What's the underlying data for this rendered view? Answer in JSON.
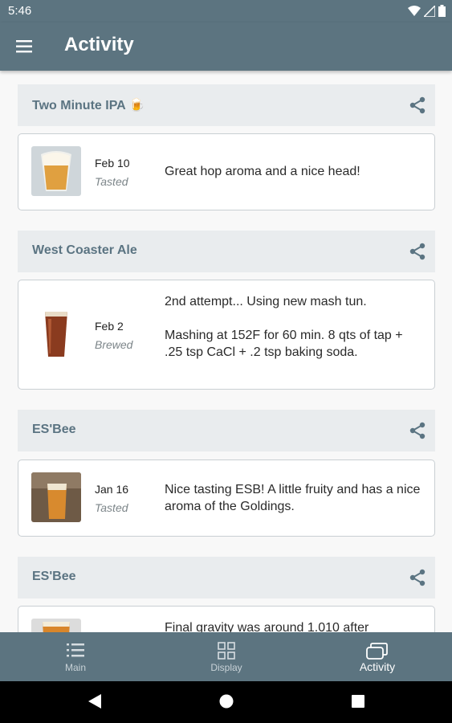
{
  "status_bar": {
    "time": "5:46"
  },
  "app_bar": {
    "title": "Activity"
  },
  "entries": [
    {
      "beer": "Two Minute IPA",
      "emoji": "🍺",
      "date": "Feb 10",
      "status": "Tasted",
      "note": "Great hop aroma and a nice head!",
      "thumb": "ipa-glass-photo"
    },
    {
      "beer": "West Coaster Ale",
      "date": "Feb 2",
      "status": "Brewed",
      "note": "2nd attempt... Using new mash tun.\n\nMashing at 152F for 60 min. 8 qts of tap + .25 tsp CaCl + .2 tsp baking soda.",
      "thumb": "pint-glass-icon"
    },
    {
      "beer": "ES'Bee",
      "date": "Jan 16",
      "status": "Tasted",
      "note": "Nice tasting ESB! A little fruity and has a nice aroma of the Goldings.",
      "thumb": "esb-glass-photo"
    },
    {
      "beer": "ES'Bee",
      "date": "",
      "status": "",
      "note": "Final gravity was around 1.010 after",
      "thumb": "beer-glass-photo"
    }
  ],
  "bottom_nav": [
    {
      "label": "Main",
      "icon": "list-icon"
    },
    {
      "label": "Display",
      "icon": "grid-icon"
    },
    {
      "label": "Activity",
      "icon": "activity-icon",
      "active": true
    }
  ]
}
